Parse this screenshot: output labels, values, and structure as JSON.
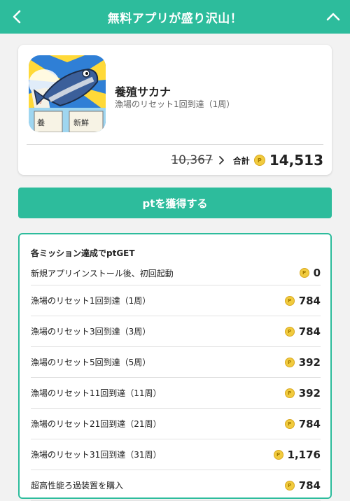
{
  "header": {
    "title": "無料アプリが盛り沢山！",
    "back_icon": "chevron-left-icon",
    "collapse_icon": "chevron-up-icon",
    "bg_color": "#2dbc9c"
  },
  "app": {
    "name": "養殖サカナ",
    "subtitle": "漁場のリセット1回到達（1周）",
    "icon": "fish-app-icon"
  },
  "price": {
    "old": "10,367",
    "total_label": "合計",
    "total_value": "14,513",
    "coin_symbol": "P"
  },
  "cta": {
    "label": "ptを獲得する"
  },
  "missions": {
    "title": "各ミッション達成でptGET",
    "items": [
      {
        "label": "新規アプリインストール後、初回起動",
        "points": "0"
      },
      {
        "label": "漁場のリセット1回到達（1周）",
        "points": "784"
      },
      {
        "label": "漁場のリセット3回到達（3周）",
        "points": "784"
      },
      {
        "label": "漁場のリセット5回到達（5周）",
        "points": "392"
      },
      {
        "label": "漁場のリセット11回到達（11周）",
        "points": "392"
      },
      {
        "label": "漁場のリセット21回到達（21周）",
        "points": "784"
      },
      {
        "label": "漁場のリセット31回到達（31周）",
        "points": "1,176"
      },
      {
        "label": "超高性能ろ過装置を購入",
        "points": "784"
      }
    ]
  }
}
